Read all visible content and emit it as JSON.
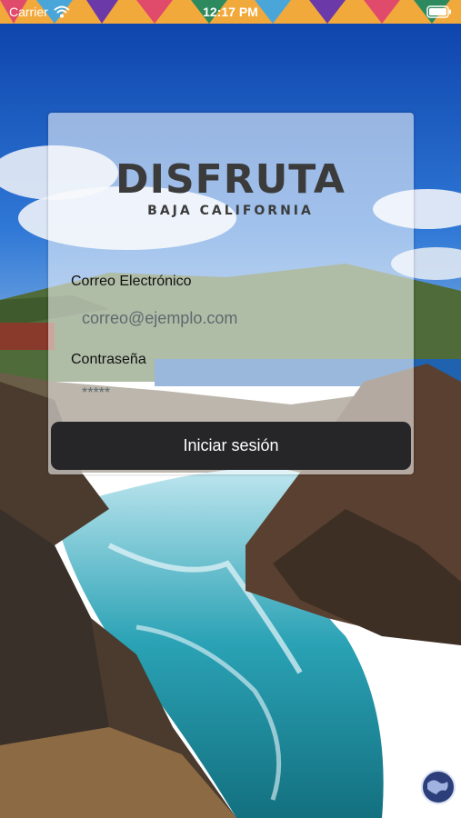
{
  "status_bar": {
    "carrier": "Carrier",
    "time": "12:17 PM"
  },
  "logo": {
    "title": "DISFRUTA",
    "subtitle": "BAJA CALIFORNIA"
  },
  "form": {
    "email_label": "Correo Electrónico",
    "email_placeholder": "correo@ejemplo.com",
    "password_label": "Contraseña",
    "password_placeholder": "*****",
    "submit_label": "Iniciar sesión"
  },
  "icons": {
    "wifi": "wifi-icon",
    "battery": "battery-icon",
    "globe": "globe-icon"
  },
  "colors": {
    "button": "#262628",
    "logo": "#3b3b3b"
  }
}
